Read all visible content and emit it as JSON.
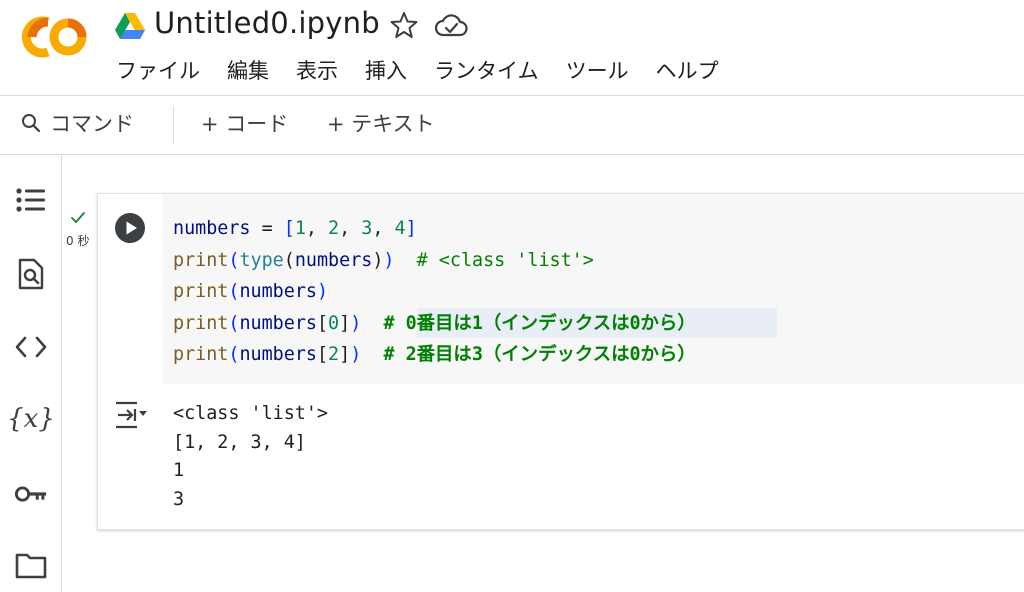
{
  "app": {
    "title": "Untitled0.ipynb",
    "logo_text": "CO"
  },
  "menu": [
    "ファイル",
    "編集",
    "表示",
    "挿入",
    "ランタイム",
    "ツール",
    "ヘルプ"
  ],
  "toolbar": {
    "command_label": "コマンド",
    "add_code_label": "+ コード",
    "add_text_label": "+ テキスト"
  },
  "sidebar": {
    "items": [
      "toc-icon",
      "find-icon",
      "code-snippets-icon",
      "variables-icon",
      "secrets-key-icon",
      "files-folder-icon"
    ],
    "variables_label": "{x}"
  },
  "cell": {
    "exec_time": "0 秒",
    "code_lines": [
      "numbers = [1, 2, 3, 4]",
      "print(type(numbers))  # <class 'list'>",
      "print(numbers)",
      "print(numbers[0])  # 0番目は1（インデックスは0から）",
      "print(numbers[2])  # 2番目は3（インデックスは0から）"
    ],
    "output_lines": [
      "<class 'list'>",
      "[1, 2, 3, 4]",
      "1",
      "3"
    ]
  },
  "colors": {
    "logo_orange": "#f9ab00",
    "logo_dark_orange": "#e8710a",
    "comment_green": "#008000",
    "function_brown": "#795e26",
    "number_green": "#098658",
    "bracket_blue": "#0431fa"
  }
}
